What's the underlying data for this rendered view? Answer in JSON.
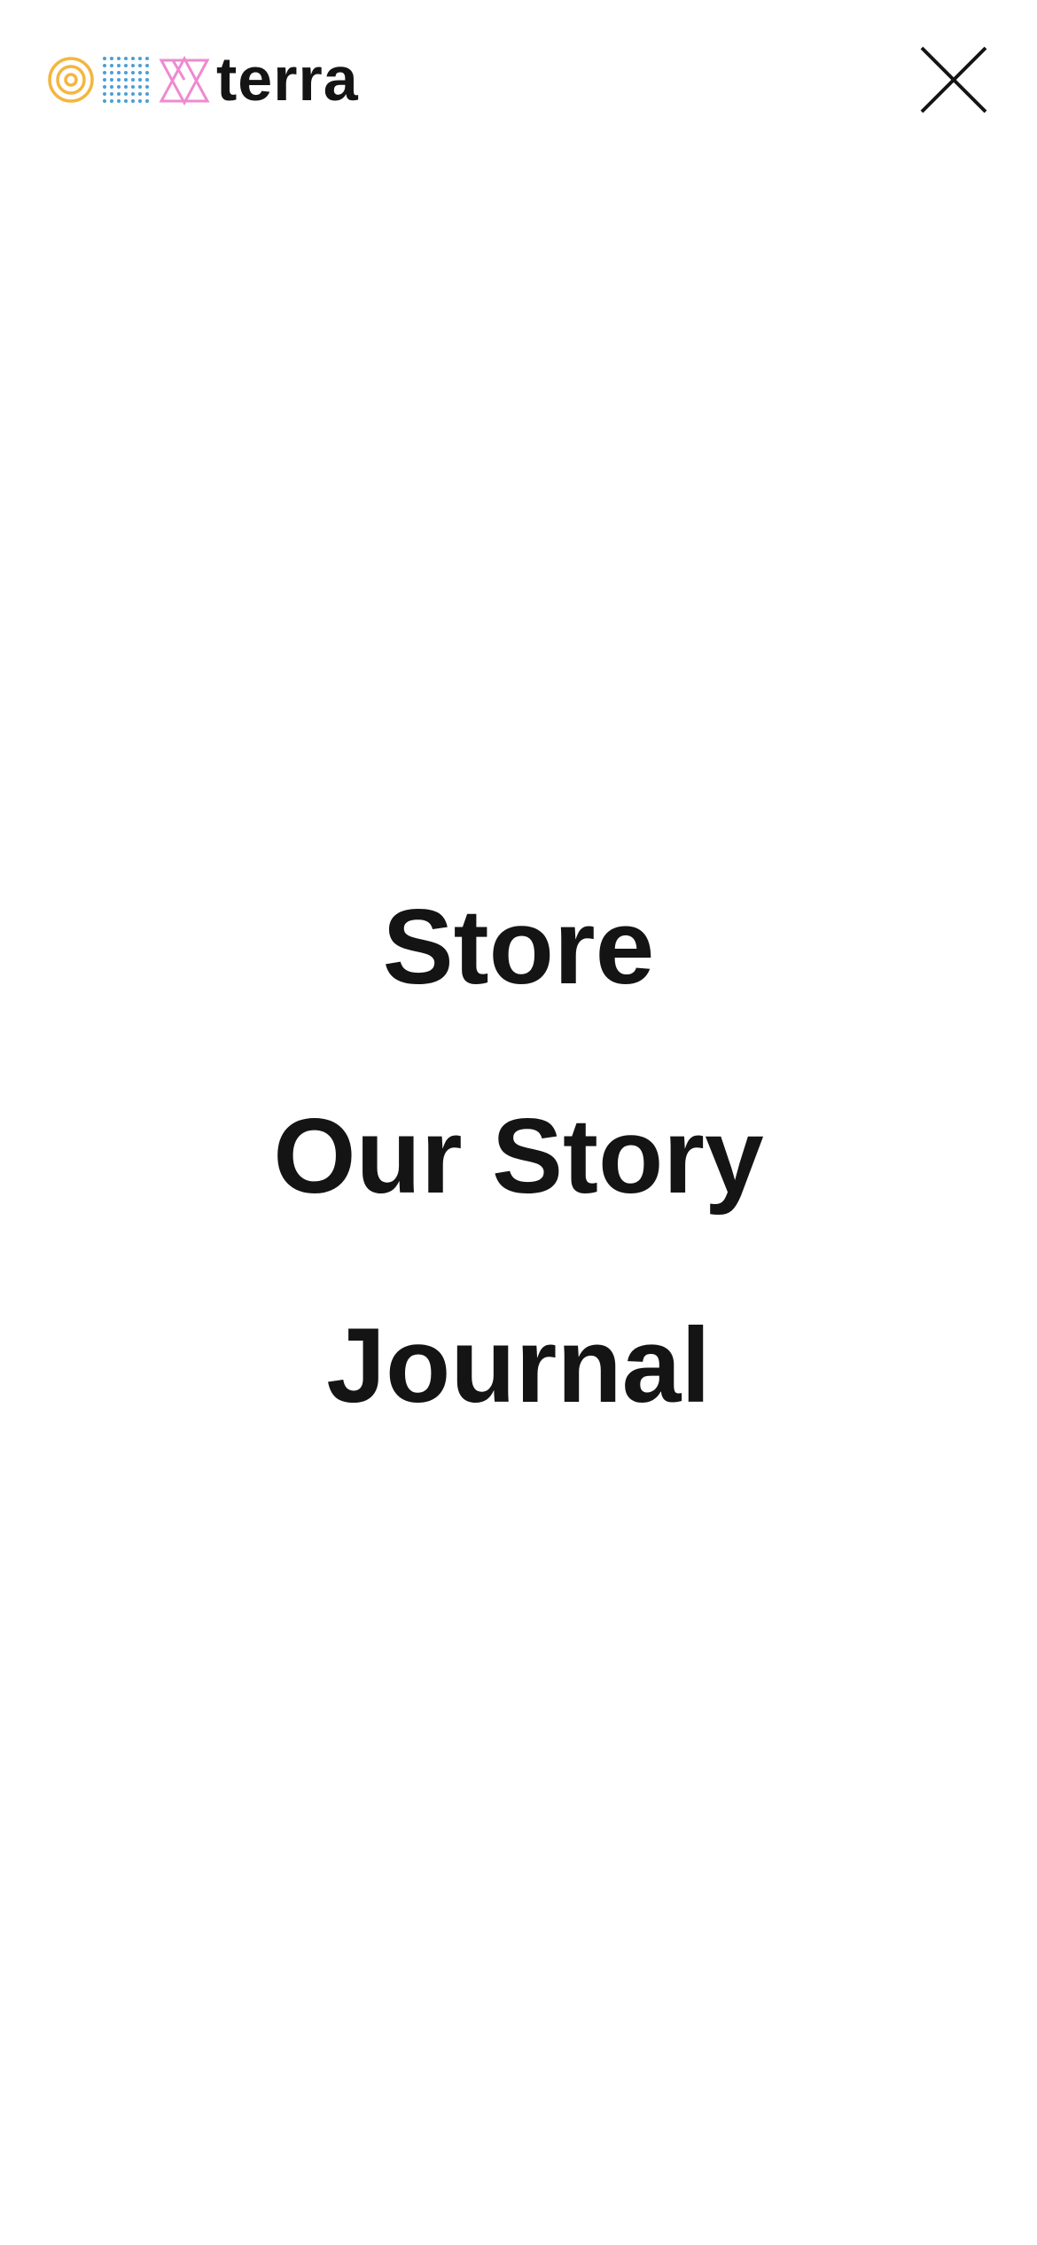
{
  "header": {
    "logo": {
      "wordmark": "terra",
      "icons": [
        "concentric-circles-icon",
        "dot-grid-icon",
        "triangles-icon"
      ],
      "colors": {
        "circles": "#f4b63f",
        "dots": "#4a9fd8",
        "triangles": "#ee8ad0",
        "text": "#141414"
      }
    },
    "close_icon": "close-icon"
  },
  "nav": {
    "items": [
      {
        "label": "Store"
      },
      {
        "label": "Our Story"
      },
      {
        "label": "Journal"
      }
    ]
  },
  "colors": {
    "background": "#ffffff",
    "text": "#141414"
  }
}
